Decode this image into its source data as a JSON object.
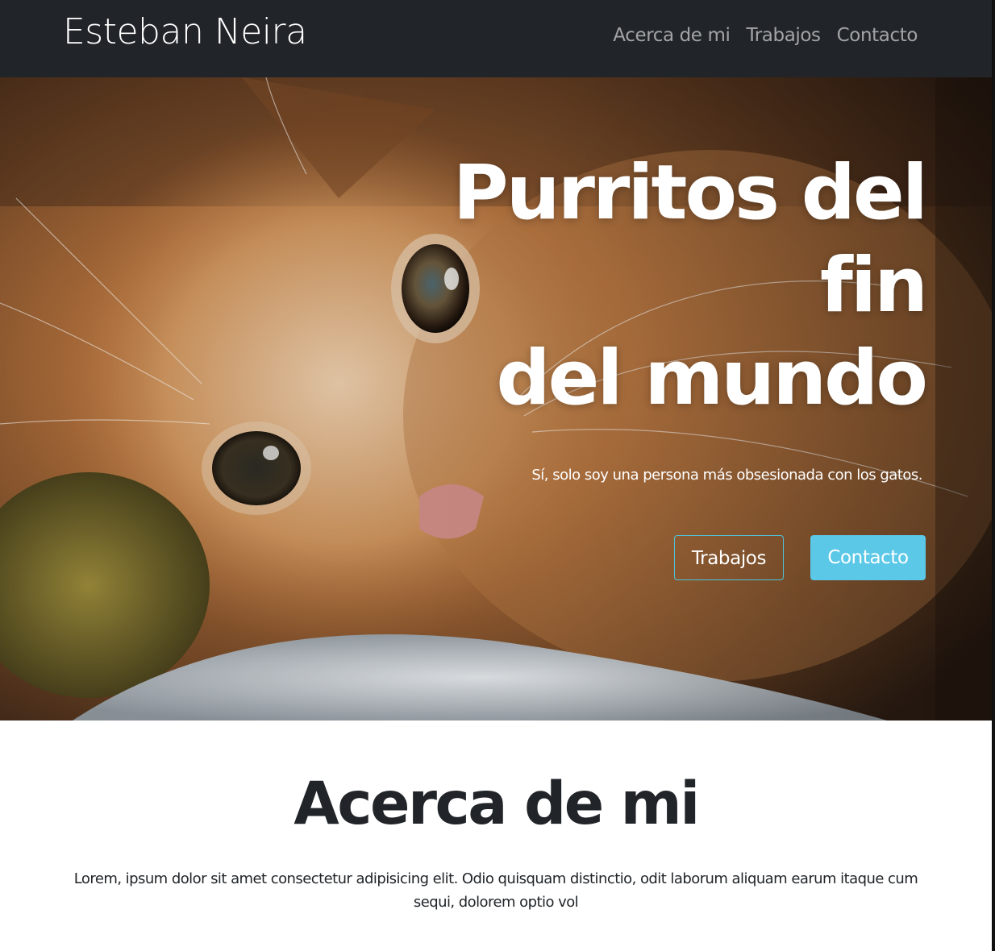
{
  "navbar": {
    "brand": "Esteban Neira",
    "links": [
      "Acerca de mi",
      "Trabajos",
      "Contacto"
    ]
  },
  "hero": {
    "title_line1": "Purritos del",
    "title_line2": "fin",
    "title_line3": "del mundo",
    "subtitle": "Sí, solo soy una persona más obsesionada con los gatos.",
    "primary_button": "Trabajos",
    "secondary_button": "Contacto",
    "image": "orange-kitten-photo"
  },
  "about": {
    "title": "Acerca de mi",
    "text": "Lorem, ipsum dolor sit amet consectetur adipisicing elit. Odio quisquam distinctio, odit laborum aliquam earum itaque cum sequi, dolorem optio vol"
  },
  "colors": {
    "navbar_bg": "#212529",
    "accent": "#5bc8e8",
    "text_dark": "#212529"
  }
}
